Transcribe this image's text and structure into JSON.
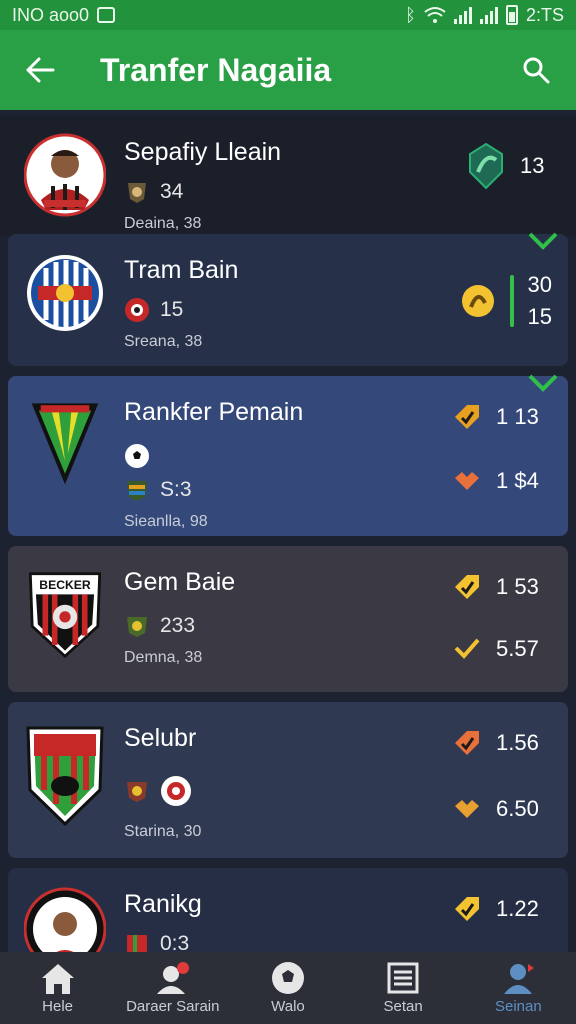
{
  "status_bar": {
    "left_text": "INO aoo0",
    "time": "2:TS"
  },
  "app_bar": {
    "title": "Tranfer Nagaiia"
  },
  "items": [
    {
      "name": "Sepafiy Lleain",
      "meta": "34",
      "sub": "Deaina, 38",
      "stat1": "13",
      "stat2": ""
    },
    {
      "name": "Tram Bain",
      "meta": "15",
      "sub": "Sreana, 38",
      "stat1": "30",
      "stat2": "15"
    },
    {
      "name": "Rankfer Pemain",
      "meta": "S:3",
      "sub": "Sieanlla, 98",
      "stat1": "1 13",
      "stat2": "1 $4"
    },
    {
      "name": "Gem Baie",
      "meta": "233",
      "sub": "Demna, 38",
      "stat1": "1 53",
      "stat2": "5.57"
    },
    {
      "name": "Selubr",
      "meta": "",
      "sub": "Starina, 30",
      "stat1": "1.56",
      "stat2": "6.50"
    },
    {
      "name": "Ranikg",
      "meta": "0:3",
      "sub": "",
      "stat1": "1.22",
      "stat2": ""
    }
  ],
  "badge_texts": {
    "item4": "BECKER"
  },
  "nav": [
    {
      "label": "Hele",
      "icon": "home-icon"
    },
    {
      "label": "Daraer Sarain",
      "icon": "user-alert-icon"
    },
    {
      "label": "Walo",
      "icon": "football-icon"
    },
    {
      "label": "Setan",
      "icon": "list-icon"
    },
    {
      "label": "Seinan",
      "icon": "profile-icon"
    }
  ],
  "colors": {
    "accent": "#2aa046",
    "status_bar": "#23923d",
    "nav_active": "#5e8fc2"
  }
}
